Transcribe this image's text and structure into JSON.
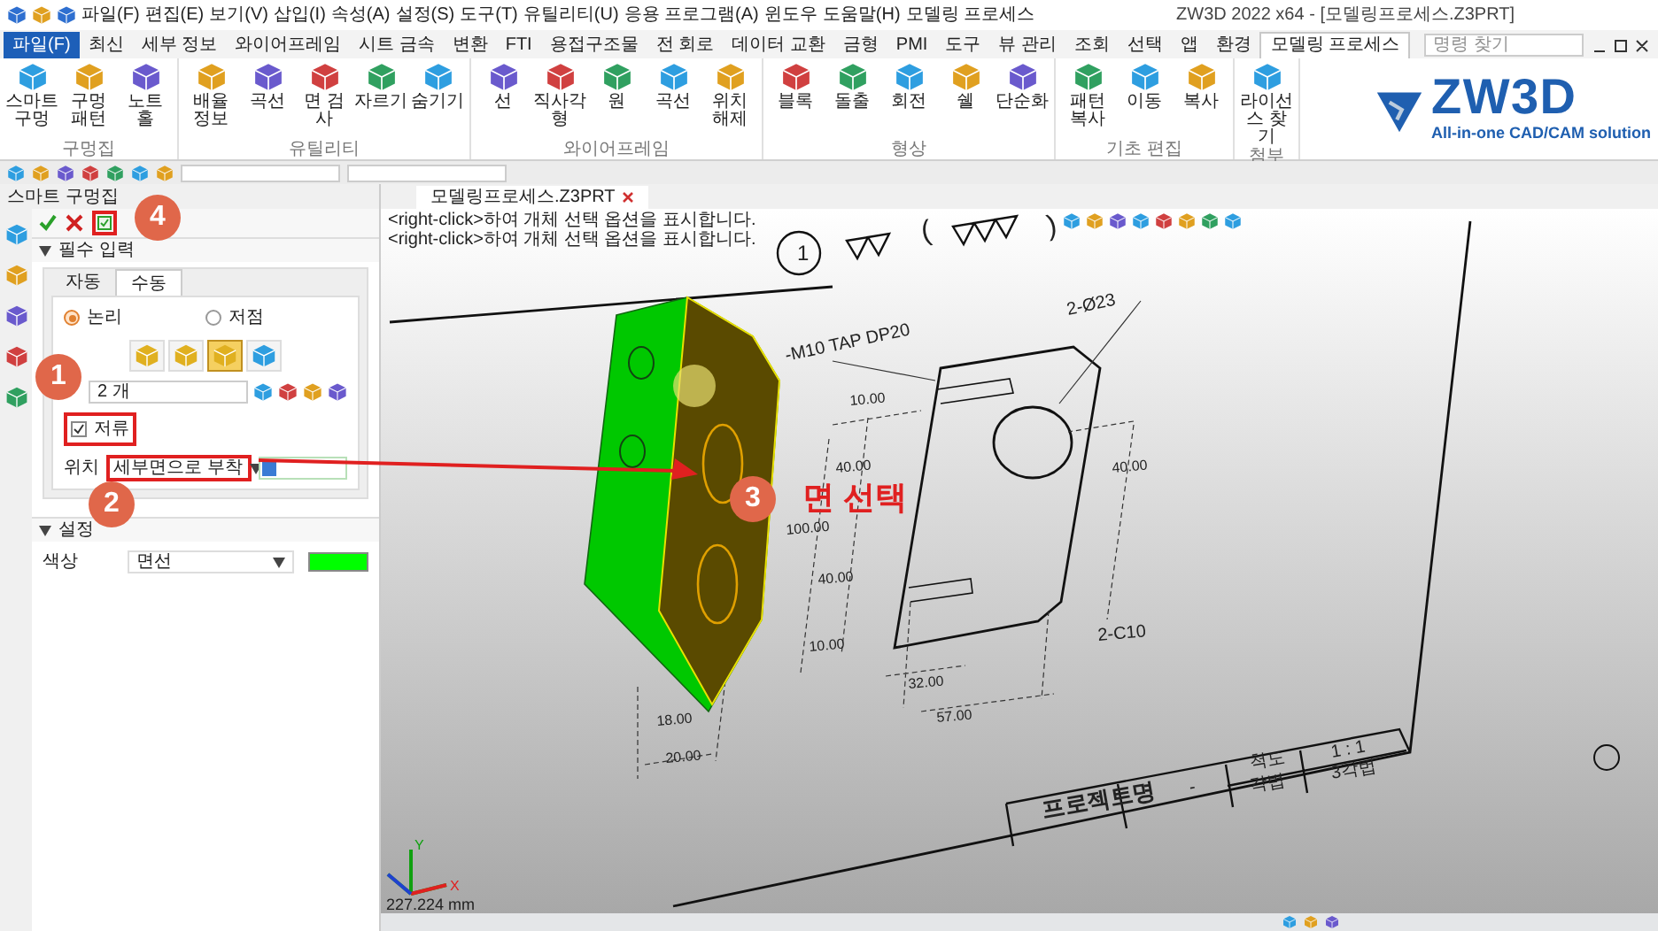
{
  "title_bar": {
    "title": "ZW3D 2022 x64 - [모델링프로세스.Z3PRT]",
    "menu": [
      "파일(F)",
      "편집(E)",
      "보기(V)",
      "삽입(I)",
      "속성(A)",
      "설정(S)",
      "도구(T)",
      "유틸리티(U)",
      "응용 프로그램(A)",
      "윈도우",
      "도움말(H)",
      "모델링 프로세스"
    ]
  },
  "search": {
    "placeholder": "명령 찾기"
  },
  "ribbon_tabs": [
    {
      "label": "파일(F)",
      "kind": "file",
      "selected": false
    },
    {
      "label": "최신",
      "kind": "tab",
      "selected": false
    },
    {
      "label": "세부 정보",
      "kind": "tab",
      "selected": false
    },
    {
      "label": "와이어프레임",
      "kind": "tab",
      "selected": false
    },
    {
      "label": "시트 금속",
      "kind": "tab",
      "selected": false
    },
    {
      "label": "변환",
      "kind": "tab",
      "selected": false
    },
    {
      "label": "FTI",
      "kind": "tab",
      "selected": false
    },
    {
      "label": "용접구조물",
      "kind": "tab",
      "selected": false
    },
    {
      "label": "전 회로",
      "kind": "tab",
      "selected": false
    },
    {
      "label": "데이터 교환",
      "kind": "tab",
      "selected": false
    },
    {
      "label": "금형",
      "kind": "tab",
      "selected": false
    },
    {
      "label": "PMI",
      "kind": "tab",
      "selected": false
    },
    {
      "label": "도구",
      "kind": "tab",
      "selected": false
    },
    {
      "label": "뷰 관리",
      "kind": "tab",
      "selected": false
    },
    {
      "label": "조회",
      "kind": "tab",
      "selected": false
    },
    {
      "label": "선택",
      "kind": "tab",
      "selected": false
    },
    {
      "label": "앱",
      "kind": "tab",
      "selected": false
    },
    {
      "label": "환경",
      "kind": "tab",
      "selected": false
    },
    {
      "label": "모델링 프로세스",
      "kind": "tab",
      "selected": true
    }
  ],
  "ribbon_groups": [
    {
      "label": "구멍집",
      "buttons": [
        "스마트 구멍",
        "구멍 패턴",
        "노트 홀"
      ]
    },
    {
      "label": "유틸리티",
      "buttons": [
        "배율 정보",
        "곡선",
        "면 검사",
        "자르기",
        "숨기기"
      ]
    },
    {
      "label": "와이어프레임",
      "buttons": [
        "선",
        "직사각형",
        "원",
        "곡선",
        "위치 해제"
      ]
    },
    {
      "label": "형상",
      "buttons": [
        "블록",
        "돌출",
        "회전",
        "쉘",
        "단순화"
      ]
    },
    {
      "label": "기초 편집",
      "buttons": [
        "패턴 복사",
        "이동",
        "복사"
      ]
    },
    {
      "label": "첨부",
      "buttons": [
        "라이선스 찾기"
      ]
    }
  ],
  "logo": {
    "name": "ZW3D",
    "tagline": "All-in-one CAD/CAM solution"
  },
  "panel": {
    "title": "스마트 구멍집",
    "section_required": "필수 입력",
    "tabs": [
      {
        "label": "자동",
        "selected": false
      },
      {
        "label": "수동",
        "selected": true
      }
    ],
    "radios": [
      {
        "label": "논리",
        "selected": true
      },
      {
        "label": "저점",
        "selected": false
      }
    ],
    "hole_types": [
      {
        "selected": false
      },
      {
        "selected": false
      },
      {
        "selected": true
      },
      {
        "selected": false
      }
    ],
    "count_field": {
      "value": "2 개"
    },
    "checkbox": {
      "label": "저류",
      "checked": true
    },
    "position": {
      "label": "위치",
      "value": "세부면으로 부착"
    },
    "section_settings": "설정",
    "color": {
      "label": "색상",
      "value": "면선",
      "color": "#00ff00"
    }
  },
  "callouts": [
    {
      "number": "4"
    },
    {
      "number": "1"
    },
    {
      "number": "2"
    },
    {
      "number": "3",
      "label": "면 선택"
    }
  ],
  "viewport": {
    "doc_tab": "모델링프로세스.Z3PRT",
    "messages": [
      "<right-click>하여 개체 선택 옵션을 표시합니다.",
      "<right-click>하여 개체 선택 옵션을 표시합니다."
    ],
    "annotations": [
      "1",
      "(",
      ")",
      "-M10 TAP DP20",
      "2-Ø23",
      "10.00",
      "40.00",
      "40.00",
      "100.00",
      "40.00",
      "10.00",
      "32.00",
      "57.00",
      "18.00",
      "20.00",
      "2-C10"
    ],
    "title_block": [
      "프로젝트명",
      "-",
      "척도",
      "1 : 1",
      "각법",
      "3각법"
    ],
    "axes": [
      "X",
      "Y"
    ],
    "scale": "227.224 mm"
  }
}
